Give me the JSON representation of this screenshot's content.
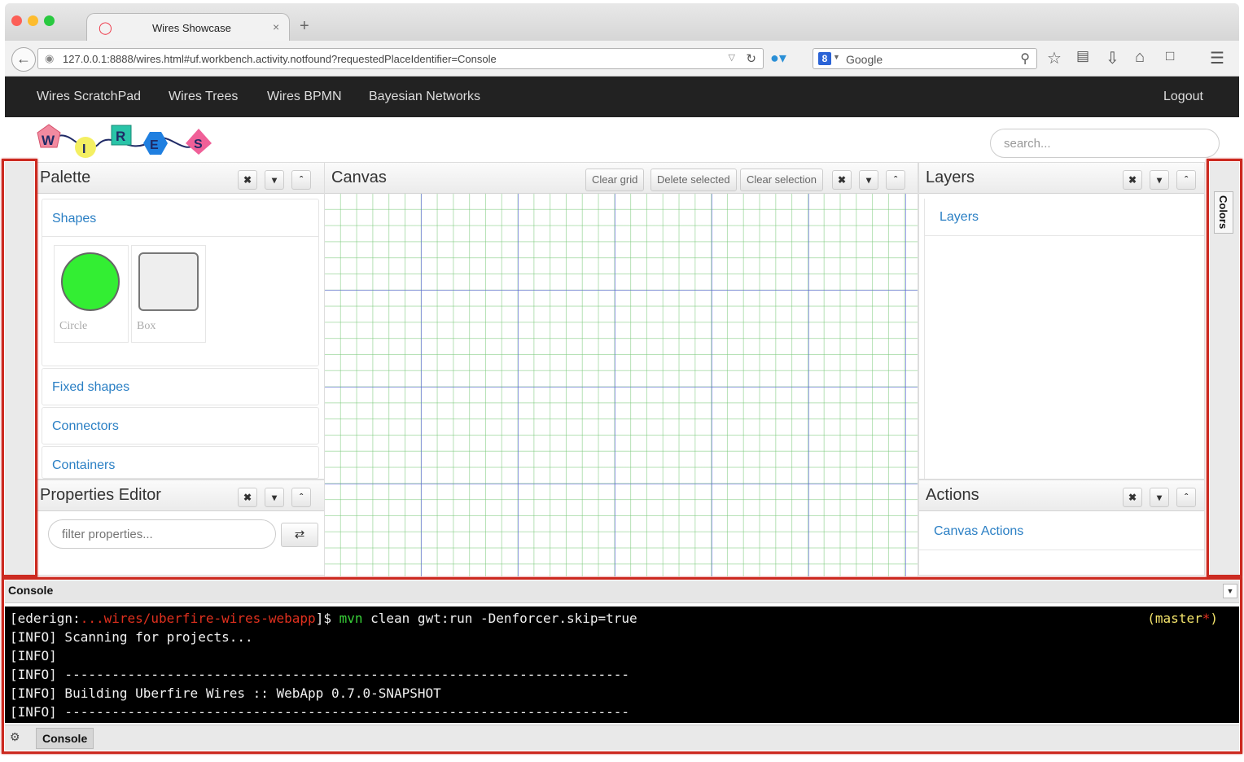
{
  "browser": {
    "tab_title": "Wires Showcase",
    "tab_close": "×",
    "new_tab": "+",
    "url": "127.0.0.1:8888/wires.html#uf.workbench.activity.notfound?requestedPlaceIdentifier=Console",
    "search_engine": "Google",
    "search_engine_logo": "8"
  },
  "nav": {
    "links": [
      "Wires ScratchPad",
      "Wires Trees",
      "Wires BPMN",
      "Bayesian Networks"
    ],
    "logout": "Logout"
  },
  "logo": {
    "letters": [
      "W",
      "I",
      "R",
      "E",
      "S"
    ]
  },
  "search": {
    "placeholder": "search..."
  },
  "palette": {
    "title": "Palette",
    "sections": [
      "Shapes",
      "Fixed shapes",
      "Connectors",
      "Containers"
    ],
    "shapes": [
      {
        "label": "Circle",
        "color": "#33ee33"
      },
      {
        "label": "Box",
        "color": "#eeeeee"
      }
    ]
  },
  "properties": {
    "title": "Properties Editor",
    "filter_placeholder": "filter properties..."
  },
  "canvas": {
    "title": "Canvas",
    "buttons": [
      "Clear grid",
      "Delete selected",
      "Clear selection"
    ]
  },
  "layers": {
    "title": "Layers",
    "item": "Layers"
  },
  "actions": {
    "title": "Actions",
    "item": "Canvas Actions"
  },
  "colors_tab": "Colors",
  "console": {
    "title": "Console",
    "prompt_user": "[ederign:",
    "prompt_path": "...wires/uberfire-wires-webapp",
    "prompt_end": "]$ ",
    "cmd": "mvn",
    "args": " clean gwt:run -Denforcer.skip=true",
    "branch_open": "(master",
    "branch_star": "*",
    "branch_close": ")",
    "lines": [
      "[INFO] Scanning for projects...",
      "[INFO]",
      "[INFO] ------------------------------------------------------------------------",
      "[INFO] Building Uberfire Wires :: WebApp 0.7.0-SNAPSHOT",
      "[INFO] ------------------------------------------------------------------------"
    ],
    "tab_label": "Console"
  },
  "colors": {
    "accent_link": "#2a7fc4",
    "highlight": "#cc2a20",
    "nav_bg": "#222222"
  }
}
